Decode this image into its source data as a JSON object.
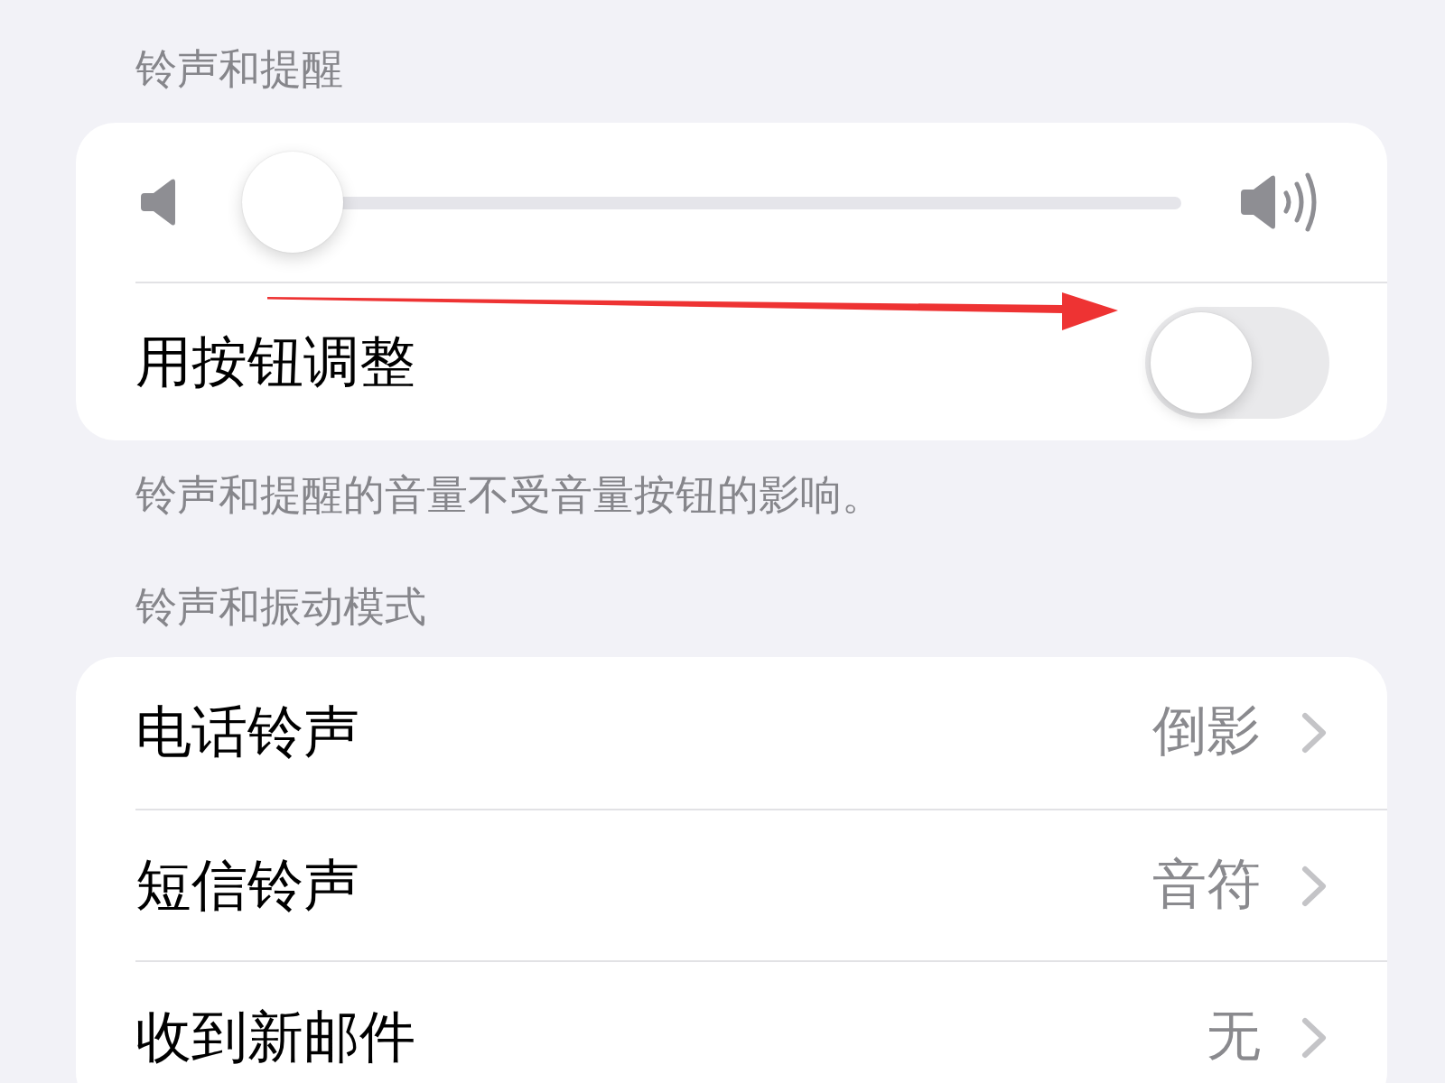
{
  "ringer_section": {
    "header": "铃声和提醒",
    "items": [
      {
        "kind": "slider",
        "level": 0
      },
      {
        "kind": "toggle",
        "label": "用按钮调整",
        "on": false
      }
    ],
    "footer": "铃声和提醒的音量不受音量按钮的影响。"
  },
  "sounds_section": {
    "header": "铃声和振动模式",
    "rows": [
      {
        "label": "电话铃声",
        "value": "倒影"
      },
      {
        "label": "短信铃声",
        "value": "音符"
      },
      {
        "label": "收到新邮件",
        "value": "无"
      }
    ]
  }
}
